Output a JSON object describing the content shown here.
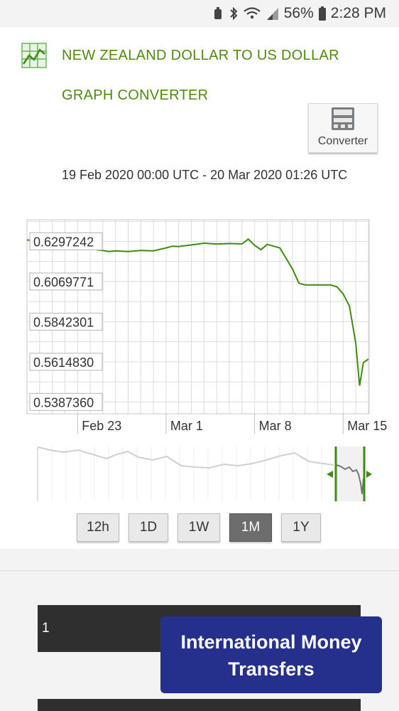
{
  "status_bar": {
    "battery_percent": "56%",
    "time": "2:28 PM",
    "icons": [
      "alarm-icon",
      "bluetooth-icon",
      "wifi-icon",
      "signal-icon",
      "battery-icon"
    ]
  },
  "header": {
    "title_line1": "NEW ZEALAND DOLLAR TO US DOLLAR",
    "title_line2": "GRAPH CONVERTER",
    "icon": "chart-icon"
  },
  "converter_button": {
    "label": "Converter",
    "icon": "calculator-icon"
  },
  "date_range": "19 Feb 2020 00:00 UTC - 20 Mar 2020 01:26 UTC",
  "range_buttons": [
    {
      "label": "12h",
      "active": false
    },
    {
      "label": "1D",
      "active": false
    },
    {
      "label": "1W",
      "active": false
    },
    {
      "label": "1M",
      "active": true
    },
    {
      "label": "1Y",
      "active": false
    }
  ],
  "amount_input": {
    "value": "1"
  },
  "banner": {
    "line1": "International Money",
    "line2": "Transfers"
  },
  "colors": {
    "accent": "#4f8a10",
    "line": "#3e8a12",
    "banner": "#252f8c"
  },
  "chart_data": {
    "type": "line",
    "y_tick_labels": [
      "0.6297242",
      "0.6069771",
      "0.5842301",
      "0.5614830",
      "0.5387360"
    ],
    "y_ticks": [
      0.6297242,
      0.6069771,
      0.5842301,
      0.561483,
      0.538736
    ],
    "x_tick_labels": [
      "Feb 23",
      "Mar 1",
      "Mar 8",
      "Mar 15"
    ],
    "x_ticks": [
      4,
      11,
      18,
      25
    ],
    "xlim": [
      0,
      27.06
    ],
    "ylim": [
      0.532,
      0.642
    ],
    "grid": true,
    "series": [
      {
        "x": [
          0,
          1,
          2,
          3,
          4,
          5,
          5.5,
          6,
          6.5,
          7,
          8,
          9,
          10,
          11,
          11.5,
          12,
          13,
          14,
          15,
          16,
          17,
          17.5,
          18,
          18.5,
          19,
          20,
          21,
          21.5,
          22,
          23,
          24,
          24.5,
          25,
          25.5,
          26,
          26.3,
          26.6,
          27
        ],
        "values": [
          0.6305,
          0.63,
          0.6293,
          0.6287,
          0.6282,
          0.6275,
          0.625,
          0.6245,
          0.624,
          0.6243,
          0.624,
          0.6246,
          0.6243,
          0.626,
          0.627,
          0.6268,
          0.6277,
          0.6287,
          0.6282,
          0.6285,
          0.6283,
          0.631,
          0.6275,
          0.625,
          0.628,
          0.626,
          0.614,
          0.606,
          0.605,
          0.605,
          0.605,
          0.604,
          0.6,
          0.593,
          0.572,
          0.548,
          0.561,
          0.563
        ]
      }
    ]
  }
}
